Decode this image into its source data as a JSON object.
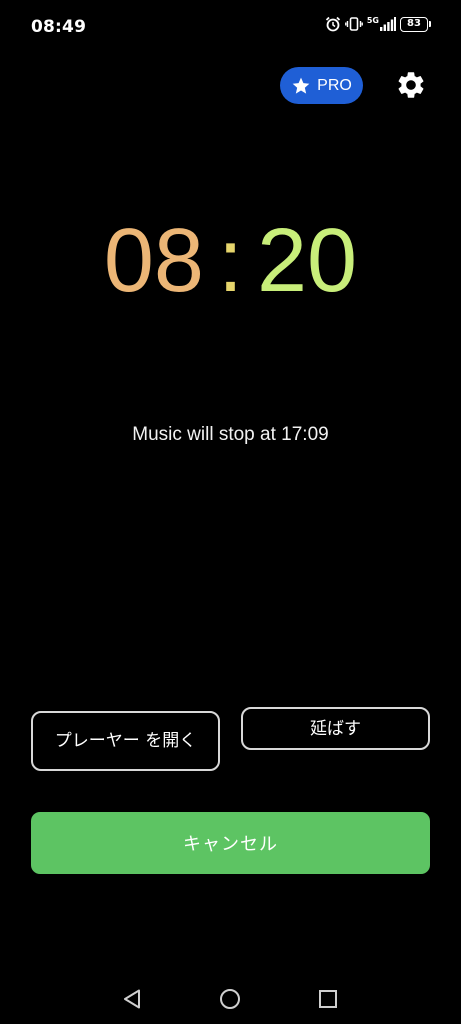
{
  "status_bar": {
    "time": "08:49",
    "network": "5G",
    "battery": "83",
    "icons": [
      "alarm-icon",
      "vibrate-icon",
      "signal-icon",
      "battery-icon"
    ]
  },
  "header": {
    "pro_label": "PRO",
    "pro_icon": "star-icon",
    "settings_icon": "gear-icon",
    "pro_color": "#1f5fd6"
  },
  "clock": {
    "hours": "08",
    "separator": ":",
    "minutes": "20",
    "gradient_colors": [
      "#ecb676",
      "#e6d56c",
      "#c8ee7a"
    ]
  },
  "message": {
    "music_stop": "Music will stop at 17:09"
  },
  "actions": {
    "open_player_label": "プレーヤー を開く",
    "snooze_label": "延ばす",
    "cancel_label": "キャンセル",
    "cancel_color": "#5dc463"
  },
  "nav_bar": {
    "icons": [
      "back-icon",
      "home-icon",
      "recents-icon"
    ]
  }
}
